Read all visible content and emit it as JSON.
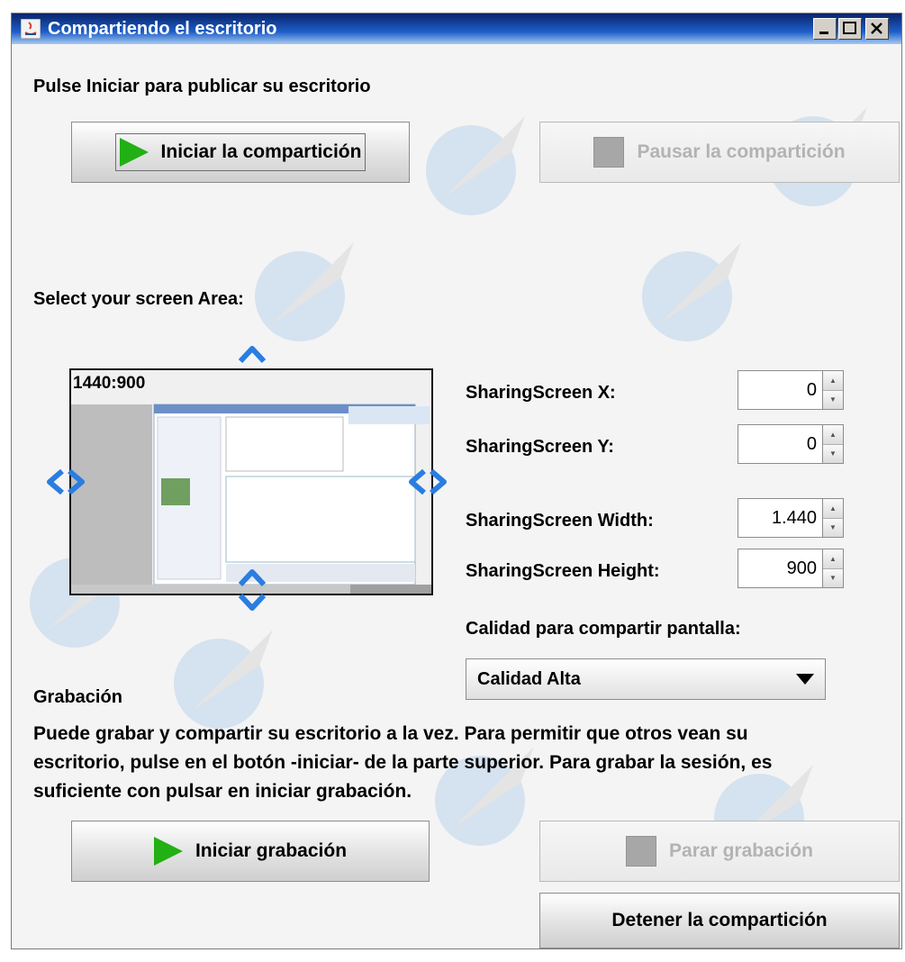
{
  "window": {
    "title": "Compartiendo el escritorio"
  },
  "publish": {
    "prompt": "Pulse Iniciar para publicar su escritorio",
    "start_label": "Iniciar la compartición",
    "pause_label": "Pausar la compartición"
  },
  "area": {
    "heading": "Select your screen Area:",
    "preview_resolution": "1440:900"
  },
  "fields": {
    "x_label": "SharingScreen X:",
    "x_value": "0",
    "y_label": "SharingScreen Y:",
    "y_value": "0",
    "width_label": "SharingScreen Width:",
    "width_value": "1.440",
    "height_label": "SharingScreen Height:",
    "height_value": "900"
  },
  "quality": {
    "label": "Calidad para compartir pantalla:",
    "selected": "Calidad Alta"
  },
  "recording": {
    "heading": "Grabación",
    "description_lines": [
      "Puede grabar y compartir su escritorio a la vez. Para permitir que otros vean su",
      "escritorio, pulse en el botón -iniciar- de la parte superior. Para grabar la sesión, es",
      "suficiente con pulsar en iniciar grabación."
    ],
    "start_label": "Iniciar grabación",
    "stop_label": "Parar grabación",
    "stop_sharing_label": "Detener la compartición"
  },
  "colors": {
    "play": "#22b014",
    "titlebar": "#0a246a",
    "arrow": "#2a7de1"
  }
}
